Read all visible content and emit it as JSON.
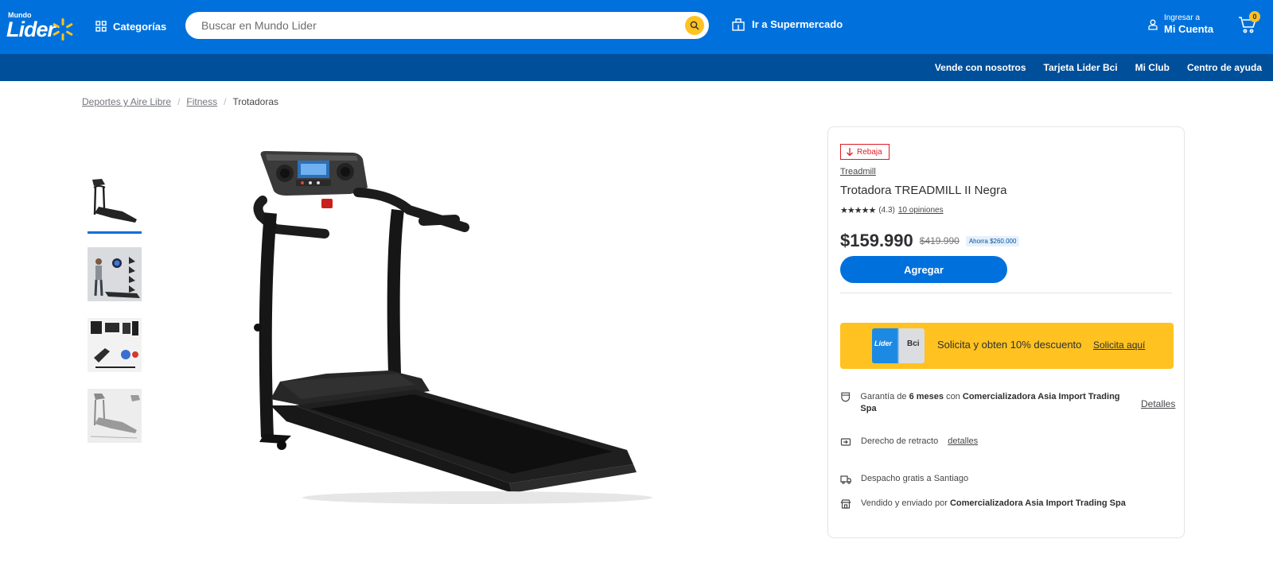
{
  "header": {
    "logo_top": "Mundo",
    "logo_main": "Lider",
    "categories_label": "Categorías",
    "search_placeholder": "Buscar en Mundo Lider",
    "supermarket_label": "Ir a Supermercado",
    "account_small": "Ingresar a",
    "account_big": "Mi Cuenta",
    "cart_count": "0",
    "colors": {
      "primary": "#0071dc",
      "secondary": "#004f9a",
      "accent": "#ffc220"
    }
  },
  "subnav": [
    "Vende con nosotros",
    "Tarjeta Lider Bci",
    "Mi Club",
    "Centro de ayuda"
  ],
  "breadcrumb": {
    "items": [
      "Deportes y Aire Libre",
      "Fitness"
    ],
    "current": "Trotadoras",
    "separator": "/"
  },
  "thumbnails": [
    {
      "icon": "treadmill-thumbnail",
      "active": true
    },
    {
      "icon": "person-treadmill-thumbnail",
      "active": false
    },
    {
      "icon": "parts-collage-thumbnail",
      "active": false
    },
    {
      "icon": "dimensions-thumbnail",
      "active": false
    }
  ],
  "product": {
    "badge": "Rebaja",
    "brand": "Treadmill",
    "title": "Trotadora TREADMILL II Negra",
    "stars": "★★★★★",
    "rating": "(4.3)",
    "reviews": "10 opiniones",
    "price": "$159.990",
    "old_price": "$419.990",
    "savings": "Ahorra $260.000",
    "add_button": "Agregar",
    "rating_value": 4.3,
    "rating_max": 5
  },
  "promo": {
    "card_left": "Lider",
    "card_right": "Bci",
    "text": "Solicita y obten 10% descuento",
    "link": "Solicita aquí"
  },
  "info": {
    "warranty_prefix": "Garantía de",
    "warranty_months": "6 meses",
    "warranty_mid": "con",
    "warranty_seller": "Comercializadora Asia Import Trading Spa",
    "warranty_link": "Detalles",
    "return_text": "Derecho de retracto",
    "return_link": "detalles",
    "shipping_text": "Despacho gratis a Santiago",
    "seller_prefix": "Vendido y enviado por",
    "seller_name": "Comercializadora Asia Import Trading Spa"
  }
}
